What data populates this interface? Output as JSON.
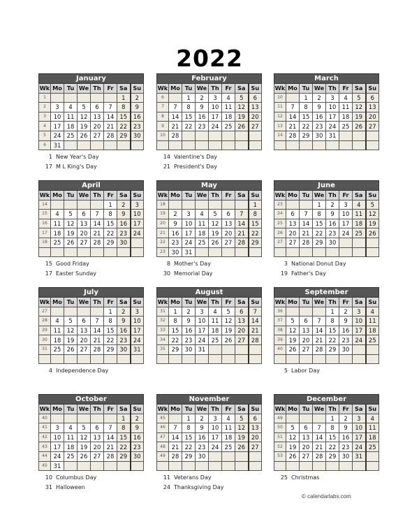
{
  "title": "2022",
  "weekday_headers": [
    "Wk",
    "Mo",
    "Tu",
    "We",
    "Th",
    "Fr",
    "Sa",
    "Su"
  ],
  "months": [
    {
      "name": "January",
      "weeks": [
        {
          "wk": "1",
          "days": [
            "",
            "",
            "",
            "",
            "",
            "1",
            "2"
          ]
        },
        {
          "wk": "2",
          "days": [
            "3",
            "4",
            "5",
            "6",
            "7",
            "8",
            "9"
          ]
        },
        {
          "wk": "3",
          "days": [
            "10",
            "11",
            "12",
            "13",
            "14",
            "15",
            "16"
          ]
        },
        {
          "wk": "4",
          "days": [
            "17",
            "18",
            "19",
            "20",
            "21",
            "22",
            "23"
          ]
        },
        {
          "wk": "5",
          "days": [
            "24",
            "25",
            "26",
            "27",
            "28",
            "29",
            "30"
          ]
        },
        {
          "wk": "6",
          "days": [
            "31",
            "",
            "",
            "",
            "",
            "",
            ""
          ]
        }
      ],
      "holidays": [
        {
          "day": "1",
          "name": "New Year's Day"
        },
        {
          "day": "17",
          "name": "M L King's Day"
        }
      ]
    },
    {
      "name": "February",
      "weeks": [
        {
          "wk": "6",
          "days": [
            "",
            "1",
            "2",
            "3",
            "4",
            "5",
            "6"
          ]
        },
        {
          "wk": "7",
          "days": [
            "7",
            "8",
            "9",
            "10",
            "11",
            "12",
            "13"
          ]
        },
        {
          "wk": "8",
          "days": [
            "14",
            "15",
            "16",
            "17",
            "18",
            "19",
            "20"
          ]
        },
        {
          "wk": "9",
          "days": [
            "21",
            "22",
            "23",
            "24",
            "25",
            "26",
            "27"
          ]
        },
        {
          "wk": "10",
          "days": [
            "28",
            "",
            "",
            "",
            "",
            "",
            ""
          ]
        },
        {
          "wk": "",
          "days": [
            "",
            "",
            "",
            "",
            "",
            "",
            ""
          ]
        }
      ],
      "holidays": [
        {
          "day": "14",
          "name": "Valentine's Day"
        },
        {
          "day": "21",
          "name": "President's Day"
        }
      ]
    },
    {
      "name": "March",
      "weeks": [
        {
          "wk": "10",
          "days": [
            "",
            "1",
            "2",
            "3",
            "4",
            "5",
            "6"
          ]
        },
        {
          "wk": "11",
          "days": [
            "7",
            "8",
            "9",
            "10",
            "11",
            "12",
            "13"
          ]
        },
        {
          "wk": "12",
          "days": [
            "14",
            "15",
            "16",
            "17",
            "18",
            "19",
            "20"
          ]
        },
        {
          "wk": "13",
          "days": [
            "21",
            "22",
            "23",
            "24",
            "25",
            "26",
            "27"
          ]
        },
        {
          "wk": "14",
          "days": [
            "28",
            "29",
            "30",
            "31",
            "",
            "",
            ""
          ]
        },
        {
          "wk": "",
          "days": [
            "",
            "",
            "",
            "",
            "",
            "",
            ""
          ]
        }
      ],
      "holidays": []
    },
    {
      "name": "April",
      "weeks": [
        {
          "wk": "14",
          "days": [
            "",
            "",
            "",
            "",
            "1",
            "2",
            "3"
          ]
        },
        {
          "wk": "15",
          "days": [
            "4",
            "5",
            "6",
            "7",
            "8",
            "9",
            "10"
          ]
        },
        {
          "wk": "16",
          "days": [
            "11",
            "12",
            "13",
            "14",
            "15",
            "16",
            "17"
          ]
        },
        {
          "wk": "17",
          "days": [
            "18",
            "19",
            "20",
            "21",
            "22",
            "23",
            "24"
          ]
        },
        {
          "wk": "18",
          "days": [
            "25",
            "26",
            "27",
            "28",
            "29",
            "30",
            ""
          ]
        },
        {
          "wk": "",
          "days": [
            "",
            "",
            "",
            "",
            "",
            "",
            ""
          ]
        }
      ],
      "holidays": [
        {
          "day": "15",
          "name": "Good Friday"
        },
        {
          "day": "17",
          "name": "Easter Sunday"
        }
      ]
    },
    {
      "name": "May",
      "weeks": [
        {
          "wk": "18",
          "days": [
            "",
            "",
            "",
            "",
            "",
            "",
            "1"
          ]
        },
        {
          "wk": "19",
          "days": [
            "2",
            "3",
            "4",
            "5",
            "6",
            "7",
            "8"
          ]
        },
        {
          "wk": "20",
          "days": [
            "9",
            "10",
            "11",
            "12",
            "13",
            "14",
            "15"
          ]
        },
        {
          "wk": "21",
          "days": [
            "16",
            "17",
            "18",
            "19",
            "20",
            "21",
            "22"
          ]
        },
        {
          "wk": "22",
          "days": [
            "23",
            "24",
            "25",
            "26",
            "27",
            "28",
            "29"
          ]
        },
        {
          "wk": "23",
          "days": [
            "30",
            "31",
            "",
            "",
            "",
            "",
            ""
          ]
        }
      ],
      "holidays": [
        {
          "day": "8",
          "name": "Mother's Day"
        },
        {
          "day": "30",
          "name": "Memorial Day"
        }
      ]
    },
    {
      "name": "June",
      "weeks": [
        {
          "wk": "23",
          "days": [
            "",
            "",
            "1",
            "2",
            "3",
            "4",
            "5"
          ]
        },
        {
          "wk": "24",
          "days": [
            "6",
            "7",
            "8",
            "9",
            "10",
            "11",
            "12"
          ]
        },
        {
          "wk": "25",
          "days": [
            "13",
            "14",
            "15",
            "16",
            "17",
            "18",
            "19"
          ]
        },
        {
          "wk": "26",
          "days": [
            "20",
            "21",
            "22",
            "23",
            "24",
            "25",
            "26"
          ]
        },
        {
          "wk": "27",
          "days": [
            "27",
            "28",
            "29",
            "30",
            "",
            "",
            ""
          ]
        },
        {
          "wk": "",
          "days": [
            "",
            "",
            "",
            "",
            "",
            "",
            ""
          ]
        }
      ],
      "holidays": [
        {
          "day": "3",
          "name": "National Donut Day"
        },
        {
          "day": "19",
          "name": "Father's Day"
        }
      ]
    },
    {
      "name": "July",
      "weeks": [
        {
          "wk": "27",
          "days": [
            "",
            "",
            "",
            "",
            "1",
            "2",
            "3"
          ]
        },
        {
          "wk": "28",
          "days": [
            "4",
            "5",
            "6",
            "7",
            "8",
            "9",
            "10"
          ]
        },
        {
          "wk": "29",
          "days": [
            "11",
            "12",
            "13",
            "14",
            "15",
            "16",
            "17"
          ]
        },
        {
          "wk": "30",
          "days": [
            "18",
            "19",
            "20",
            "21",
            "22",
            "23",
            "24"
          ]
        },
        {
          "wk": "31",
          "days": [
            "25",
            "26",
            "27",
            "28",
            "29",
            "30",
            "31"
          ]
        },
        {
          "wk": "",
          "days": [
            "",
            "",
            "",
            "",
            "",
            "",
            ""
          ]
        }
      ],
      "holidays": [
        {
          "day": "4",
          "name": "Independence Day"
        }
      ]
    },
    {
      "name": "August",
      "weeks": [
        {
          "wk": "31",
          "days": [
            "1",
            "2",
            "3",
            "4",
            "5",
            "6",
            "7"
          ]
        },
        {
          "wk": "32",
          "days": [
            "8",
            "9",
            "10",
            "11",
            "12",
            "13",
            "14"
          ]
        },
        {
          "wk": "33",
          "days": [
            "15",
            "16",
            "17",
            "18",
            "19",
            "20",
            "21"
          ]
        },
        {
          "wk": "34",
          "days": [
            "22",
            "23",
            "24",
            "25",
            "26",
            "27",
            "28"
          ]
        },
        {
          "wk": "35",
          "days": [
            "29",
            "30",
            "31",
            "",
            "",
            "",
            ""
          ]
        },
        {
          "wk": "",
          "days": [
            "",
            "",
            "",
            "",
            "",
            "",
            ""
          ]
        }
      ],
      "holidays": []
    },
    {
      "name": "September",
      "weeks": [
        {
          "wk": "36",
          "days": [
            "",
            "",
            "",
            "1",
            "2",
            "3",
            "4"
          ]
        },
        {
          "wk": "37",
          "days": [
            "5",
            "6",
            "7",
            "8",
            "9",
            "10",
            "11"
          ]
        },
        {
          "wk": "38",
          "days": [
            "12",
            "13",
            "14",
            "15",
            "16",
            "17",
            "18"
          ]
        },
        {
          "wk": "39",
          "days": [
            "19",
            "20",
            "21",
            "22",
            "23",
            "24",
            "25"
          ]
        },
        {
          "wk": "40",
          "days": [
            "26",
            "27",
            "28",
            "29",
            "30",
            "",
            ""
          ]
        },
        {
          "wk": "",
          "days": [
            "",
            "",
            "",
            "",
            "",
            "",
            ""
          ]
        }
      ],
      "holidays": [
        {
          "day": "5",
          "name": "Labor Day"
        }
      ]
    },
    {
      "name": "October",
      "weeks": [
        {
          "wk": "40",
          "days": [
            "",
            "",
            "",
            "",
            "",
            "1",
            "2"
          ]
        },
        {
          "wk": "41",
          "days": [
            "3",
            "4",
            "5",
            "6",
            "7",
            "8",
            "9"
          ]
        },
        {
          "wk": "42",
          "days": [
            "10",
            "11",
            "12",
            "13",
            "14",
            "15",
            "16"
          ]
        },
        {
          "wk": "43",
          "days": [
            "17",
            "18",
            "19",
            "20",
            "21",
            "22",
            "23"
          ]
        },
        {
          "wk": "44",
          "days": [
            "24",
            "25",
            "26",
            "27",
            "28",
            "29",
            "30"
          ]
        },
        {
          "wk": "45",
          "days": [
            "31",
            "",
            "",
            "",
            "",
            "",
            ""
          ]
        }
      ],
      "holidays": [
        {
          "day": "10",
          "name": "Columbus Day"
        },
        {
          "day": "31",
          "name": "Halloween"
        }
      ]
    },
    {
      "name": "November",
      "weeks": [
        {
          "wk": "45",
          "days": [
            "",
            "1",
            "2",
            "3",
            "4",
            "5",
            "6"
          ]
        },
        {
          "wk": "46",
          "days": [
            "7",
            "8",
            "9",
            "10",
            "11",
            "12",
            "13"
          ]
        },
        {
          "wk": "47",
          "days": [
            "14",
            "15",
            "16",
            "17",
            "18",
            "19",
            "20"
          ]
        },
        {
          "wk": "48",
          "days": [
            "21",
            "22",
            "23",
            "24",
            "25",
            "26",
            "27"
          ]
        },
        {
          "wk": "49",
          "days": [
            "28",
            "29",
            "30",
            "",
            "",
            "",
            ""
          ]
        },
        {
          "wk": "",
          "days": [
            "",
            "",
            "",
            "",
            "",
            "",
            ""
          ]
        }
      ],
      "holidays": [
        {
          "day": "11",
          "name": "Veterans Day"
        },
        {
          "day": "24",
          "name": "Thanksgiving Day"
        }
      ]
    },
    {
      "name": "December",
      "weeks": [
        {
          "wk": "49",
          "days": [
            "",
            "",
            "",
            "1",
            "2",
            "3",
            "4"
          ]
        },
        {
          "wk": "50",
          "days": [
            "5",
            "6",
            "7",
            "8",
            "9",
            "10",
            "11"
          ]
        },
        {
          "wk": "51",
          "days": [
            "12",
            "13",
            "14",
            "15",
            "16",
            "17",
            "18"
          ]
        },
        {
          "wk": "52",
          "days": [
            "19",
            "20",
            "21",
            "22",
            "23",
            "24",
            "25"
          ]
        },
        {
          "wk": "53",
          "days": [
            "26",
            "27",
            "28",
            "29",
            "30",
            "31",
            ""
          ]
        },
        {
          "wk": "",
          "days": [
            "",
            "",
            "",
            "",
            "",
            "",
            ""
          ]
        }
      ],
      "holidays": [
        {
          "day": "25",
          "name": "Christmas"
        }
      ]
    }
  ],
  "footer": {
    "copyright": "© calendarlabs.com"
  },
  "colors": {
    "month_header_bg": "#565656",
    "weekday_header_bg": "#d9d9d9",
    "shaded_cell_bg": "#eeebe1",
    "weekday_cell_bg": "#ffffff"
  }
}
